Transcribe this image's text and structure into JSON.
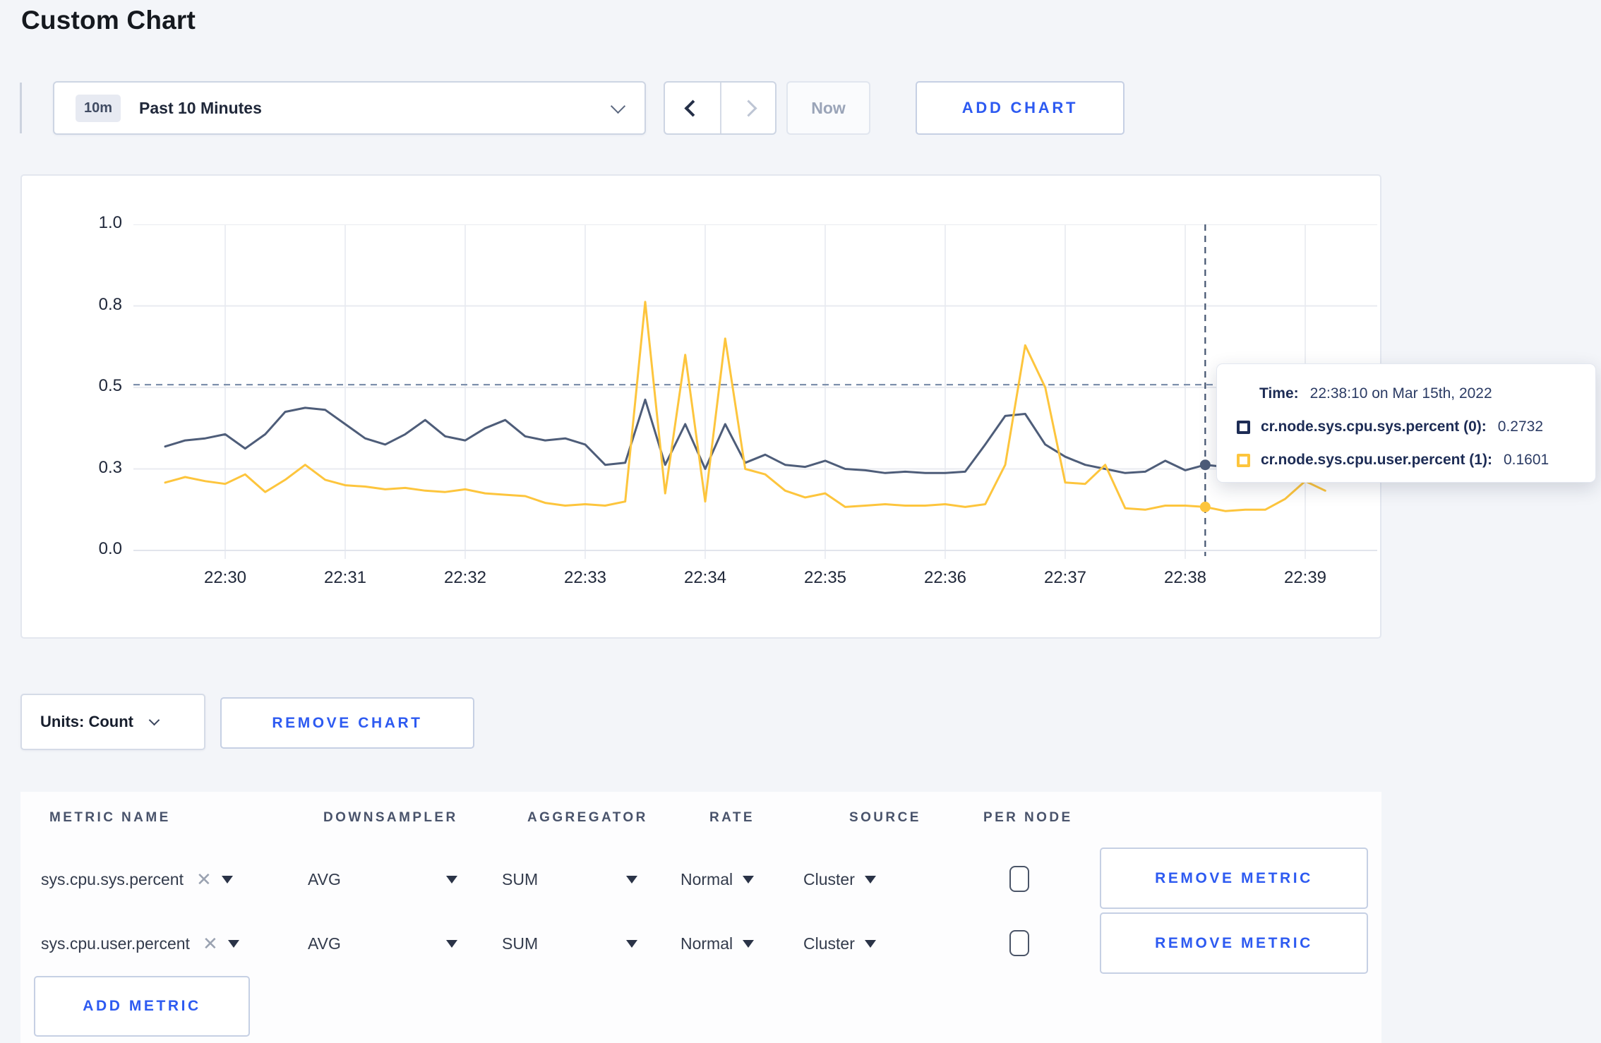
{
  "page": {
    "title": "Custom Chart"
  },
  "toolbar": {
    "time_window_badge": "10m",
    "time_window_label": "Past 10 Minutes",
    "now_label": "Now",
    "add_chart_label": "ADD CHART"
  },
  "chart_data": {
    "type": "line",
    "title": "",
    "xlabel": "",
    "ylabel": "",
    "x_axis": {
      "ticks": [
        "22:30",
        "22:31",
        "22:32",
        "22:33",
        "22:34",
        "22:35",
        "22:36",
        "22:37",
        "22:38",
        "22:39"
      ]
    },
    "y_axis": {
      "tick_values": [
        0,
        0.3,
        0.5,
        0.8,
        1.0
      ],
      "tick_labels": [
        "0.0",
        "0.3",
        "0.5",
        "0.8",
        "1.0"
      ],
      "ylim": [
        0,
        1.0
      ]
    },
    "grid": true,
    "threshold_value": 0.51,
    "crosshair": {
      "t": 490,
      "time_label": "22:38:10"
    },
    "series": [
      {
        "name": "cr.node.sys.cpu.sys.percent",
        "color": "#4e5d79",
        "points": [
          [
            -30,
            0.355
          ],
          [
            -20,
            0.37
          ],
          [
            -10,
            0.375
          ],
          [
            0,
            0.385
          ],
          [
            10,
            0.35
          ],
          [
            20,
            0.385
          ],
          [
            30,
            0.44
          ],
          [
            40,
            0.45
          ],
          [
            50,
            0.445
          ],
          [
            60,
            0.41
          ],
          [
            70,
            0.375
          ],
          [
            80,
            0.36
          ],
          [
            90,
            0.385
          ],
          [
            100,
            0.42
          ],
          [
            110,
            0.38
          ],
          [
            120,
            0.37
          ],
          [
            130,
            0.4
          ],
          [
            140,
            0.42
          ],
          [
            150,
            0.38
          ],
          [
            160,
            0.37
          ],
          [
            170,
            0.375
          ],
          [
            180,
            0.36
          ],
          [
            190,
            0.31
          ],
          [
            200,
            0.315
          ],
          [
            210,
            0.47
          ],
          [
            220,
            0.31
          ],
          [
            230,
            0.41
          ],
          [
            240,
            0.3
          ],
          [
            250,
            0.41
          ],
          [
            260,
            0.315
          ],
          [
            270,
            0.335
          ],
          [
            280,
            0.31
          ],
          [
            290,
            0.305
          ],
          [
            300,
            0.32
          ],
          [
            310,
            0.3
          ],
          [
            320,
            0.295
          ],
          [
            330,
            0.285
          ],
          [
            340,
            0.29
          ],
          [
            350,
            0.285
          ],
          [
            360,
            0.285
          ],
          [
            370,
            0.29
          ],
          [
            380,
            0.36
          ],
          [
            390,
            0.43
          ],
          [
            400,
            0.435
          ],
          [
            410,
            0.36
          ],
          [
            420,
            0.33
          ],
          [
            430,
            0.31
          ],
          [
            440,
            0.3
          ],
          [
            450,
            0.285
          ],
          [
            460,
            0.29
          ],
          [
            470,
            0.32
          ],
          [
            480,
            0.295
          ],
          [
            490,
            0.31
          ],
          [
            500,
            0.305
          ],
          [
            510,
            0.3
          ],
          [
            520,
            0.3
          ],
          [
            530,
            0.3
          ],
          [
            540,
            0.3
          ],
          [
            550,
            0.3
          ]
        ]
      },
      {
        "name": "cr.node.sys.cpu.user.percent",
        "color": "#fdc53d",
        "points": [
          [
            -30,
            0.25
          ],
          [
            -20,
            0.27
          ],
          [
            -10,
            0.255
          ],
          [
            0,
            0.245
          ],
          [
            10,
            0.28
          ],
          [
            20,
            0.215
          ],
          [
            30,
            0.26
          ],
          [
            40,
            0.31
          ],
          [
            50,
            0.26
          ],
          [
            60,
            0.24
          ],
          [
            70,
            0.235
          ],
          [
            80,
            0.225
          ],
          [
            90,
            0.23
          ],
          [
            100,
            0.22
          ],
          [
            110,
            0.215
          ],
          [
            120,
            0.225
          ],
          [
            130,
            0.21
          ],
          [
            140,
            0.205
          ],
          [
            150,
            0.2
          ],
          [
            160,
            0.175
          ],
          [
            170,
            0.165
          ],
          [
            180,
            0.17
          ],
          [
            190,
            0.165
          ],
          [
            200,
            0.18
          ],
          [
            210,
            0.81
          ],
          [
            220,
            0.21
          ],
          [
            230,
            0.62
          ],
          [
            240,
            0.18
          ],
          [
            250,
            0.68
          ],
          [
            260,
            0.3
          ],
          [
            270,
            0.28
          ],
          [
            280,
            0.22
          ],
          [
            290,
            0.195
          ],
          [
            300,
            0.21
          ],
          [
            310,
            0.16
          ],
          [
            320,
            0.165
          ],
          [
            330,
            0.17
          ],
          [
            340,
            0.165
          ],
          [
            350,
            0.165
          ],
          [
            360,
            0.17
          ],
          [
            370,
            0.16
          ],
          [
            380,
            0.17
          ],
          [
            390,
            0.31
          ],
          [
            400,
            0.655
          ],
          [
            410,
            0.5
          ],
          [
            420,
            0.25
          ],
          [
            430,
            0.245
          ],
          [
            440,
            0.31
          ],
          [
            450,
            0.155
          ],
          [
            460,
            0.15
          ],
          [
            470,
            0.165
          ],
          [
            480,
            0.165
          ],
          [
            490,
            0.16
          ],
          [
            500,
            0.145
          ],
          [
            510,
            0.15
          ],
          [
            520,
            0.15
          ],
          [
            530,
            0.19
          ],
          [
            540,
            0.255
          ],
          [
            550,
            0.22
          ]
        ]
      }
    ]
  },
  "tooltip": {
    "time_label": "Time:",
    "time_value": "22:38:10 on Mar 15th, 2022",
    "series": [
      {
        "label": "cr.node.sys.cpu.sys.percent (0):",
        "value": "0.2732",
        "color": "#1d2c55"
      },
      {
        "label": "cr.node.sys.cpu.user.percent (1):",
        "value": "0.1601",
        "color": "#fdc53d"
      }
    ]
  },
  "units_bar": {
    "units_label": "Units: Count",
    "remove_chart_label": "REMOVE CHART"
  },
  "metrics_table": {
    "headers": [
      "METRIC NAME",
      "DOWNSAMPLER",
      "AGGREGATOR",
      "RATE",
      "SOURCE",
      "PER NODE"
    ],
    "rows": [
      {
        "metric": "sys.cpu.sys.percent",
        "downsampler": "AVG",
        "aggregator": "SUM",
        "rate": "Normal",
        "source": "Cluster",
        "per_node_checked": false,
        "remove_label": "REMOVE METRIC"
      },
      {
        "metric": "sys.cpu.user.percent",
        "downsampler": "AVG",
        "aggregator": "SUM",
        "rate": "Normal",
        "source": "Cluster",
        "per_node_checked": false,
        "remove_label": "REMOVE METRIC"
      }
    ],
    "add_metric_label": "ADD METRIC"
  }
}
